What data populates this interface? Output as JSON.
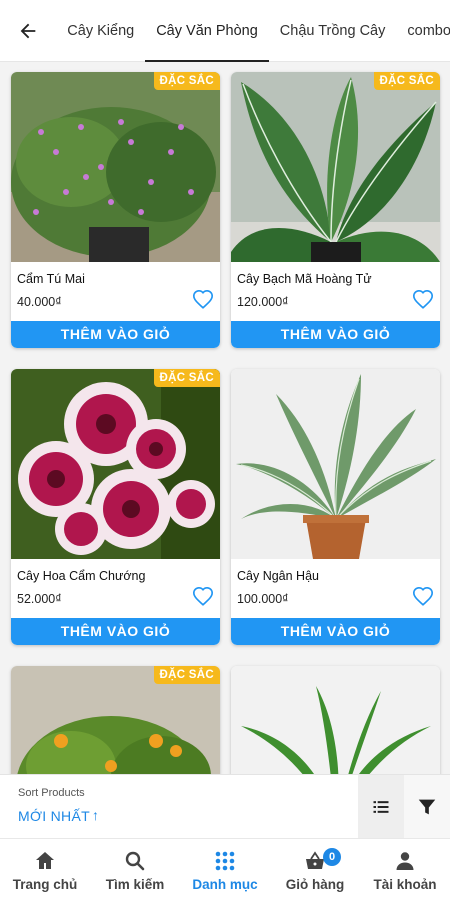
{
  "header": {
    "tabs": [
      {
        "label": "Cây Kiểng",
        "active": false
      },
      {
        "label": "Cây Văn Phòng",
        "active": true
      },
      {
        "label": "Chậu Trồng Cây",
        "active": false
      },
      {
        "label": "combo",
        "active": false
      }
    ]
  },
  "products": [
    {
      "name": "Cẩm Tú Mai",
      "price": "40.000₫",
      "badge": "ĐẶC SẮC",
      "button": "THÊM VÀO GIỎ"
    },
    {
      "name": "Cây Bạch Mã Hoàng Tử",
      "price": "120.000₫",
      "badge": "ĐẶC SẮC",
      "button": "THÊM VÀO GIỎ"
    },
    {
      "name": "Cây Hoa Cẩm Chướng",
      "price": "52.000₫",
      "badge": "ĐẶC SẮC",
      "button": "THÊM VÀO GIỎ"
    },
    {
      "name": "Cây Ngân Hậu",
      "price": "100.000₫",
      "badge": "",
      "button": "THÊM VÀO GIỎ"
    },
    {
      "name": "",
      "price": "",
      "badge": "ĐẶC SẮC",
      "button": ""
    },
    {
      "name": "",
      "price": "",
      "badge": "",
      "button": ""
    }
  ],
  "sort": {
    "label": "Sort Products",
    "value": "MỚI NHẤT",
    "arrow": "↑"
  },
  "nav": {
    "items": [
      {
        "label": "Trang chủ",
        "icon": "home-icon"
      },
      {
        "label": "Tìm kiếm",
        "icon": "search-icon"
      },
      {
        "label": "Danh mục",
        "icon": "grid-icon",
        "active": true
      },
      {
        "label": "Giỏ hàng",
        "icon": "basket-icon",
        "badge": "0"
      },
      {
        "label": "Tài khoản",
        "icon": "person-icon"
      }
    ]
  },
  "colors": {
    "accent": "#2196f3",
    "badge": "#f6b91c"
  }
}
